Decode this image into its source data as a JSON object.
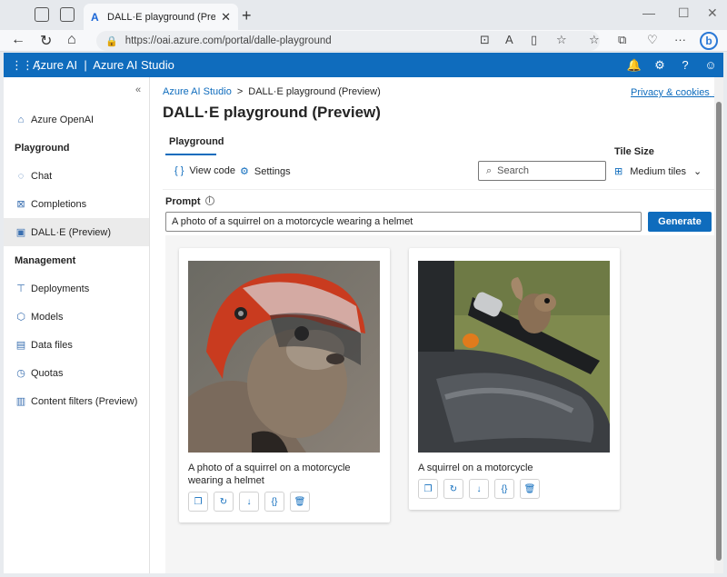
{
  "browser": {
    "tab_title": "DALL·E playground (Preview) | Az",
    "tab_close": "✕",
    "new_tab": "+",
    "url": "https://oai.azure.com/portal/dalle-playground"
  },
  "azure_bar": {
    "brand": "Azure AI  |  Azure AI Studio"
  },
  "sidebar": {
    "items": [
      {
        "label": "Azure OpenAI",
        "icon": "home-icon"
      },
      {
        "label": "Chat",
        "icon": "chat-icon"
      },
      {
        "label": "Completions",
        "icon": "completions-icon"
      },
      {
        "label": "DALL·E (Preview)",
        "icon": "image-icon"
      },
      {
        "label": "Deployments",
        "icon": "deployments-icon"
      },
      {
        "label": "Models",
        "icon": "models-icon"
      },
      {
        "label": "Data files",
        "icon": "file-icon"
      },
      {
        "label": "Quotas",
        "icon": "quota-icon"
      },
      {
        "label": "Content filters (Preview)",
        "icon": "filter-icon"
      }
    ],
    "headings": {
      "playground": "Playground",
      "management": "Management"
    }
  },
  "main": {
    "breadcrumb_root": "Azure AI Studio",
    "breadcrumb_sep": ">",
    "breadcrumb_current": "DALL·E playground (Preview)",
    "privacy": "Privacy & cookies",
    "title": "DALL·E playground (Preview)",
    "tab": "Playground",
    "view_code": "View code",
    "settings": "Settings",
    "tile_size_label": "Tile Size",
    "search_placeholder": "Search",
    "tiles_value": "Medium tiles",
    "prompt_label": "Prompt",
    "prompt_value": "A photo of a squirrel on a motorcycle wearing a helmet",
    "generate": "Generate"
  },
  "cards": [
    {
      "caption": "A photo of a squirrel on a motorcycle wearing a helmet"
    },
    {
      "caption": "A squirrel on a motorcycle"
    }
  ]
}
